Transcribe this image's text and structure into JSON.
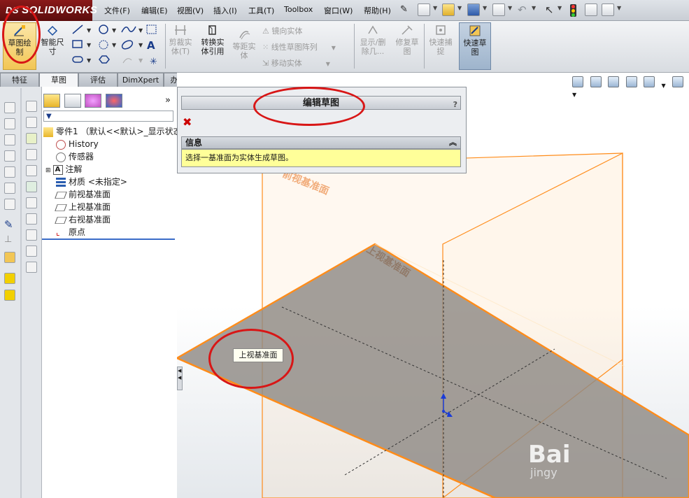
{
  "app": {
    "brand": "SOLIDWORKS",
    "brand_prefix": "DS"
  },
  "menu": [
    "文件(F)",
    "编辑(E)",
    "视图(V)",
    "插入(I)",
    "工具(T)",
    "Toolbox",
    "窗口(W)",
    "帮助(H)"
  ],
  "command_manager": {
    "sketch": "草图绘\n制",
    "smart_dim": "智能尺\n寸",
    "trim": "剪裁实\n体(T)",
    "convert": "转换实\n体引用",
    "offset": "等距实\n体",
    "mirror": "镜向实体",
    "linear_pattern": "线性草图阵列",
    "move": "移动实体",
    "show_delete": "显示/删\n除几...",
    "repair": "修复草\n图",
    "quick_snap": "快速捕\n捉",
    "rapid_sketch": "快速草\n图"
  },
  "tabs": [
    "特征",
    "草图",
    "评估",
    "DimXpert",
    "办公室产品"
  ],
  "tree": {
    "root": "零件1 （默认<<默认>_显示状态",
    "items": [
      "History",
      "传感器",
      "注解",
      "材质 <未指定>",
      "前视基准面",
      "上视基准面",
      "右视基准面",
      "原点"
    ]
  },
  "property_manager": {
    "title": "编辑草图",
    "help": "?",
    "info_header": "信息",
    "info_text": "选择一基准面为实体生成草图。"
  },
  "viewport": {
    "tooltip": "上视基准面",
    "front_plane_label": "前视基准面",
    "top_plane_label": "上视基准面",
    "watermark_big": "Bai",
    "watermark_small": "jingy"
  },
  "colors": {
    "plane_edge": "#ff8c1a",
    "plane_fill": "#8f8a85",
    "highlight": "#d81616",
    "info_bg": "#ffff99"
  }
}
